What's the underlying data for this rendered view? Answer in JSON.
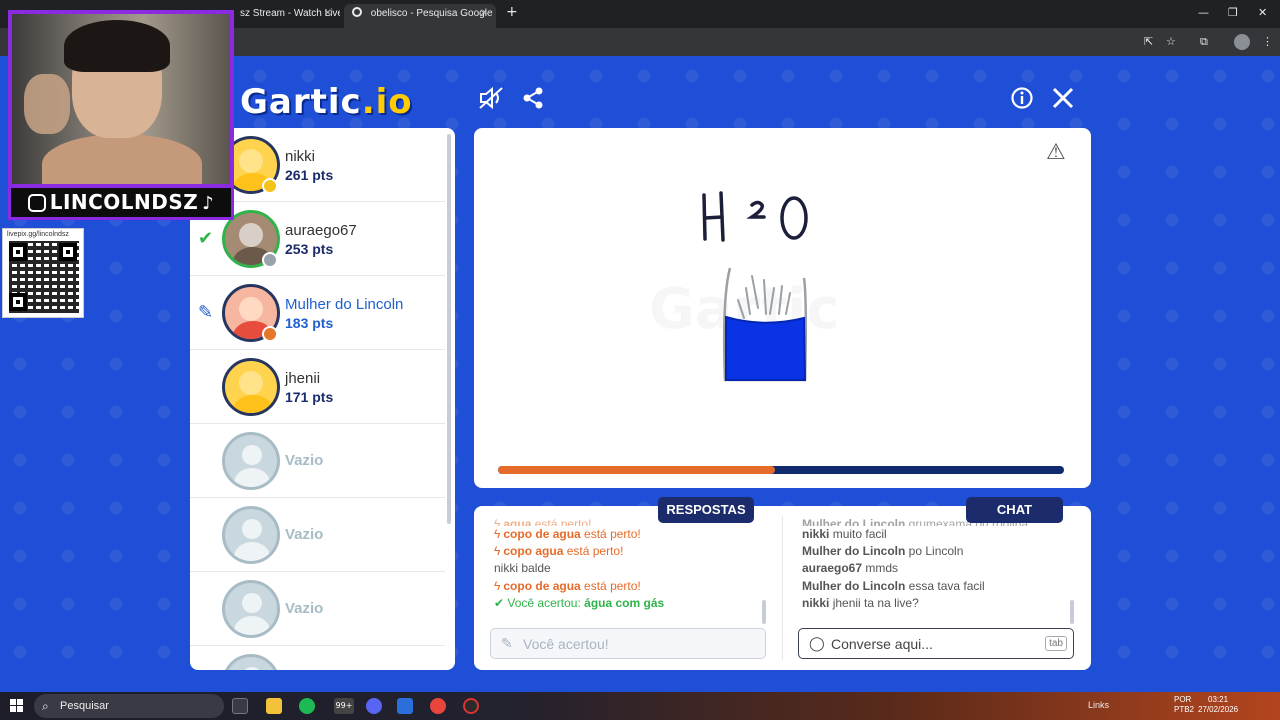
{
  "browser": {
    "tabs": [
      {
        "title": "sz Stream - Watch Live",
        "active": false
      },
      {
        "title": "obelisco - Pesquisa Google",
        "active": true
      }
    ],
    "new_tab": "+",
    "min": "—",
    "max": "❐",
    "close": "✕"
  },
  "game": {
    "logo_main": "Gartic",
    "logo_accent": ".io",
    "header_icons": [
      "mute-icon",
      "share-icon",
      "info-icon",
      "close-icon"
    ],
    "players": [
      {
        "name": "nikki",
        "points": "261 pts",
        "status_color": "#f5c21b",
        "state": "normal"
      },
      {
        "name": "auraego67",
        "points": "253 pts",
        "status_color": "#9aa3ad",
        "state": "guessed"
      },
      {
        "name": "Mulher do Lincoln",
        "points": "183 pts",
        "status_color": "#e5762a",
        "state": "drawing"
      },
      {
        "name": "jhenii",
        "points": "171 pts",
        "status_color": "",
        "state": "normal"
      },
      {
        "name": "Vazio",
        "points": "",
        "state": "empty"
      },
      {
        "name": "Vazio",
        "points": "",
        "state": "empty"
      },
      {
        "name": "Vazio",
        "points": "",
        "state": "empty"
      }
    ],
    "drawing_text": "H²O",
    "timer_progress": 0.49,
    "accent_orange": "#e56b2a",
    "navy": "#1b2b6b",
    "answers_label": "RESPOSTAS",
    "chat_label": "CHAT",
    "answers": [
      {
        "type": "near",
        "word": "agua",
        "text": "está perto!"
      },
      {
        "type": "near",
        "word": "copo de agua",
        "text": "está perto!"
      },
      {
        "type": "near",
        "word": "copo agua",
        "text": "está perto!"
      },
      {
        "type": "msg",
        "who": "nikki",
        "text": "balde"
      },
      {
        "type": "near",
        "word": "copo de agua",
        "text": "está perto!"
      },
      {
        "type": "ok",
        "text": "Você acertou:",
        "word": "água com gás"
      }
    ],
    "chat": [
      {
        "who": "Mulher do Lincoln",
        "text": "grumexama ou rodilha"
      },
      {
        "who": "nikki",
        "text": "muito facil"
      },
      {
        "who": "Mulher do Lincoln",
        "text": "po Lincoln"
      },
      {
        "who": "auraego67",
        "text": "mmds"
      },
      {
        "who": "Mulher do Lincoln",
        "text": "essa tava facil"
      },
      {
        "who": "nikki",
        "text": "jhenii ta na live?"
      }
    ],
    "answer_input_placeholder": "Você acertou!",
    "chat_input_placeholder": "Converse aqui...",
    "tab_key": "tab"
  },
  "overlay": {
    "handle": "LINCOLNDSZ",
    "qr_label": "livepix.gg/lincolndsz"
  },
  "taskbar": {
    "search_label": "Pesquisar",
    "badge": "99+",
    "links": "Links",
    "lang_1": "POR",
    "lang_2": "PTB2",
    "time": "03:21",
    "date": "27/02/2026"
  }
}
